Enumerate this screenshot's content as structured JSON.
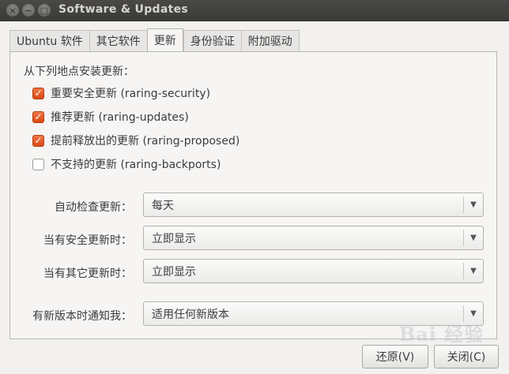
{
  "window": {
    "title": "Software & Updates",
    "controls": {
      "close_glyph": "×",
      "minimize_glyph": "−",
      "maximize_glyph": "□"
    }
  },
  "tabs": [
    {
      "label": "Ubuntu 软件",
      "active": false
    },
    {
      "label": "其它软件",
      "active": false
    },
    {
      "label": "更新",
      "active": true
    },
    {
      "label": "身份验证",
      "active": false
    },
    {
      "label": "附加驱动",
      "active": false
    }
  ],
  "updates": {
    "section_label": "从下列地点安装更新：",
    "sources": [
      {
        "label": "重要安全更新 (raring-security)",
        "checked": true
      },
      {
        "label": "推荐更新 (raring-updates)",
        "checked": true
      },
      {
        "label": "提前释放出的更新 (raring-proposed)",
        "checked": true
      },
      {
        "label": "不支持的更新 (raring-backports)",
        "checked": false
      }
    ],
    "auto_check": {
      "label": "自动检查更新：",
      "value": "每天"
    },
    "security_updates": {
      "label": "当有安全更新时：",
      "value": "立即显示"
    },
    "other_updates": {
      "label": "当有其它更新时：",
      "value": "立即显示"
    },
    "notify_new_version": {
      "label": "有新版本时通知我：",
      "value": "适用任何新版本"
    }
  },
  "buttons": {
    "revert": "还原(V)",
    "close": "关闭(C)"
  },
  "watermark": "Bai 经验",
  "colors": {
    "checkbox_accent": "#dd4814",
    "titlebar": "#3b3a37"
  }
}
